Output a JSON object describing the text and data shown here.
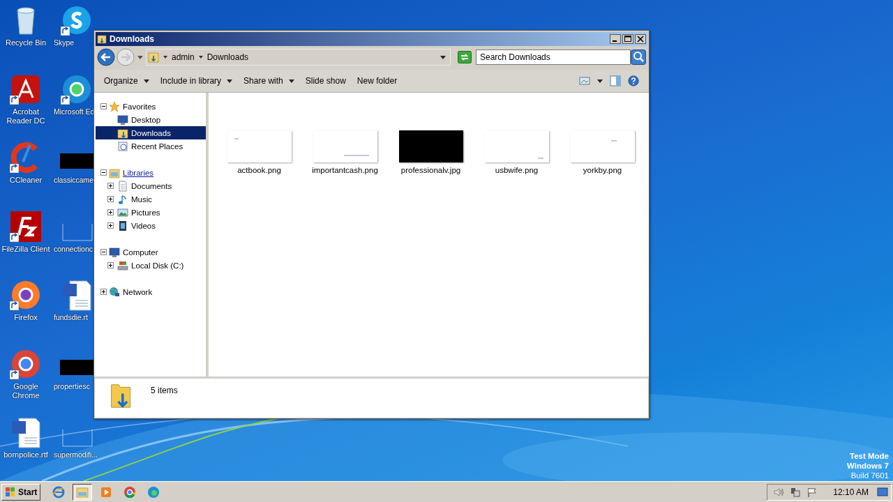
{
  "desktop_icons": [
    {
      "label": "Recycle Bin",
      "kind": "recycle",
      "shortcut": false
    },
    {
      "label": "Skype",
      "kind": "skype",
      "shortcut": true
    },
    {
      "label": "Acrobat Reader DC",
      "kind": "acrobat",
      "shortcut": true
    },
    {
      "label": "Microsoft Ed",
      "kind": "edge",
      "shortcut": true
    },
    {
      "label": "CCleaner",
      "kind": "ccleaner",
      "shortcut": true
    },
    {
      "label": "classiccame",
      "kind": "black",
      "shortcut": false
    },
    {
      "label": "FileZilla Client",
      "kind": "filezilla",
      "shortcut": true
    },
    {
      "label": "connectionc",
      "kind": "blank",
      "shortcut": false
    },
    {
      "label": "Firefox",
      "kind": "firefox",
      "shortcut": true
    },
    {
      "label": "fundsdie.rt",
      "kind": "word",
      "shortcut": false
    },
    {
      "label": "Google Chrome",
      "kind": "chrome",
      "shortcut": true
    },
    {
      "label": "propertiesc",
      "kind": "black",
      "shortcut": false
    },
    {
      "label": "bornpolice.rtf",
      "kind": "word",
      "shortcut": false
    },
    {
      "label": "supermodifi...",
      "kind": "blank",
      "shortcut": false
    }
  ],
  "window": {
    "title": "Downloads",
    "breadcrumb": [
      "admin",
      "Downloads"
    ],
    "search": {
      "placeholder": "Search Downloads"
    },
    "toolbar": [
      {
        "label": "Organize",
        "dropdown": true
      },
      {
        "label": "Include in library",
        "dropdown": true
      },
      {
        "label": "Share with",
        "dropdown": true
      },
      {
        "label": "Slide show",
        "dropdown": false
      },
      {
        "label": "New folder",
        "dropdown": false
      }
    ],
    "nav": [
      {
        "label": "Favorites",
        "kind": "star",
        "expanded": true,
        "selected": false,
        "children": [
          {
            "label": "Desktop",
            "kind": "desktop",
            "selected": false
          },
          {
            "label": "Downloads",
            "kind": "downloads",
            "selected": true
          },
          {
            "label": "Recent Places",
            "kind": "recent",
            "selected": false
          }
        ]
      },
      {
        "label": "Libraries",
        "kind": "libraries",
        "link": true,
        "expanded": true,
        "selected": false,
        "children": [
          {
            "label": "Documents",
            "kind": "documents",
            "expanded": false,
            "selected": false
          },
          {
            "label": "Music",
            "kind": "music",
            "expanded": false,
            "selected": false
          },
          {
            "label": "Pictures",
            "kind": "pictures",
            "expanded": false,
            "selected": false
          },
          {
            "label": "Videos",
            "kind": "videos",
            "expanded": false,
            "selected": false
          }
        ]
      },
      {
        "label": "Computer",
        "kind": "computer",
        "expanded": true,
        "selected": false,
        "children": [
          {
            "label": "Local Disk (C:)",
            "kind": "disk",
            "expanded": false,
            "selected": false
          }
        ]
      },
      {
        "label": "Network",
        "kind": "network",
        "expanded": false,
        "selected": false
      }
    ],
    "files": [
      {
        "name": "actbook.png",
        "kind": "document"
      },
      {
        "name": "importantcash.png",
        "kind": "document"
      },
      {
        "name": "professionalv.jpg"
      },
      {
        "name": "usbwife.png",
        "kind": "document"
      },
      {
        "name": "yorkby.png",
        "kind": "document"
      }
    ],
    "details": {
      "count": "5 items"
    }
  },
  "desktop_notice": [
    "Test Mode",
    "Windows 7",
    "Build 7601"
  ],
  "taskbar": {
    "start": "Start",
    "apps": [
      {
        "kind": "ie",
        "selected": false
      },
      {
        "kind": "explorer",
        "selected": true
      },
      {
        "kind": "media",
        "selected": false
      },
      {
        "kind": "chrome",
        "selected": false
      },
      {
        "kind": "edge",
        "selected": false
      }
    ],
    "clock": "12:10 AM"
  }
}
